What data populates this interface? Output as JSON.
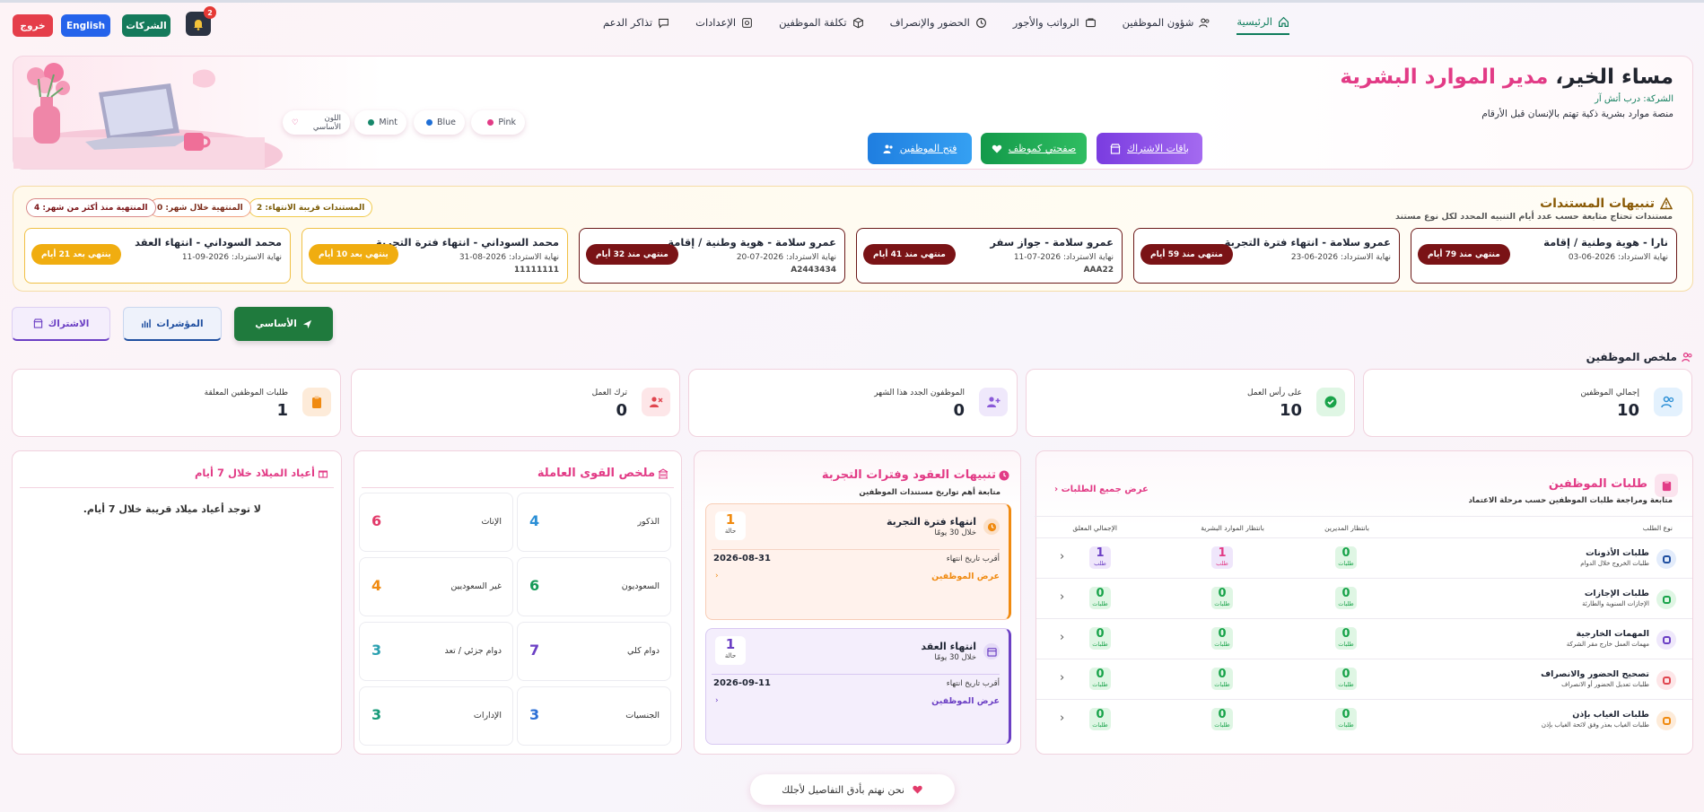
{
  "nav": {
    "home": "الرئيسية",
    "employees": "شؤون الموظفين",
    "payroll": "الرواتب والأجور",
    "attendance": "الحضور والإنصراف",
    "cost": "تكلفة الموظفين",
    "settings": "الإعدادات",
    "tickets": "تذاكر الدعم",
    "companies": "الشركات",
    "english": "English",
    "logout": "خروج",
    "notif_count": "2"
  },
  "hero": {
    "greet": "مساء الخير،",
    "role": "مدير الموارد البشرية",
    "company": "الشركة: درب أتش آر",
    "tagline": "منصة موارد بشرية ذكية تهتم بالإنسان قبل الأرقام",
    "btn_subscription": "باقات الاشتراك",
    "btn_employee_page": "صفحتي كموظف",
    "btn_open_employees": "فتح الموظفين",
    "themes": [
      "Pink",
      "Blue",
      "Mint",
      "اللون الأساسي"
    ]
  },
  "docs": {
    "title": "تنبيهات المستندات",
    "subtitle": "مستندات تحتاج متابعة حسب عدد أيام التنبيه المحدد لكل نوع مستند",
    "chips": {
      "near": "المستندات قريبة الانتهاء: 2",
      "month": "المنتهية خلال شهر: 0",
      "older": "المنتهية منذ أكثر من شهر: 4"
    },
    "cards": [
      {
        "name": "نارا - هوية وطنية / إقامة",
        "expiry": "نهاية الاسترداد: 2026-06-03",
        "number": "",
        "badge": "منتهي منذ 79 أيام"
      },
      {
        "name": "عمرو سلامة - انتهاء فترة التجربة",
        "expiry": "نهاية الاسترداد: 2026-06-23",
        "number": "",
        "badge": "منتهي منذ 59 أيام"
      },
      {
        "name": "عمرو سلامة - جواز سفر",
        "expiry": "نهاية الاسترداد: 2026-07-11",
        "number": "AAA22",
        "badge": "منتهي منذ 41 أيام"
      },
      {
        "name": "عمرو سلامة - هوية وطنية / إقامة",
        "expiry": "نهاية الاسترداد: 2026-07-20",
        "number": "A2443434",
        "badge": "منتهي منذ 32 أيام"
      },
      {
        "name": "محمد السوداني - انتهاء فترة التجربة",
        "expiry": "نهاية الاسترداد: 2026-08-31",
        "number": "11111111",
        "badge": "ينتهي بعد 10 أيام"
      },
      {
        "name": "محمد السوداني - انتهاء العقد",
        "expiry": "نهاية الاسترداد: 2026-09-11",
        "number": "",
        "badge": "ينتهي بعد 21 أيام"
      }
    ]
  },
  "tabs": {
    "main": "الأساسي",
    "indicators": "المؤشرات",
    "subscription": "الاشتراك"
  },
  "summary": {
    "title": "ملخص الموظفين",
    "stats": [
      {
        "label": "إجمالي الموظفين",
        "value": "10"
      },
      {
        "label": "على رأس العمل",
        "value": "10"
      },
      {
        "label": "الموظفون الجدد هذا الشهر",
        "value": "0"
      },
      {
        "label": "ترك العمل",
        "value": "0"
      },
      {
        "label": "طلبات الموظفين المعلقة",
        "value": "1"
      }
    ]
  },
  "requests": {
    "title": "طلبات الموظفين",
    "subtitle": "متابعة ومراجعة طلبات الموظفين حسب مرحلة الاعتماد",
    "view_all": "عرض جميع الطلبات",
    "headers": [
      "نوع الطلب",
      "بانتظار المديرين",
      "بانتظار الموارد البشرية",
      "الإجمالي المعلق"
    ],
    "unit": "طلب",
    "unit_pl": "طلبات",
    "rows": [
      {
        "name": "طلبات الأذونات",
        "desc": "طلبات الخروج خلال الدوام",
        "mgr": "0",
        "hr": "1",
        "total": "1"
      },
      {
        "name": "طلبات الإجازات",
        "desc": "الإجازات السنوية والطارئة",
        "mgr": "0",
        "hr": "0",
        "total": "0"
      },
      {
        "name": "المهمات الخارجية",
        "desc": "مهمات العمل خارج مقر الشركة",
        "mgr": "0",
        "hr": "0",
        "total": "0"
      },
      {
        "name": "تصحيح الحضور والانصراف",
        "desc": "طلبات تعديل الحضور أو الانصراف",
        "mgr": "0",
        "hr": "0",
        "total": "0"
      },
      {
        "name": "طلبات الغياب بإذن",
        "desc": "طلبات الغياب بعذر وفق لائحة الغياب بإذن",
        "mgr": "0",
        "hr": "0",
        "total": "0"
      }
    ]
  },
  "contracts": {
    "title": "تنبيهات العقود وفترات التجربة",
    "subtitle": "متابعة أهم تواريخ مستندات الموظفين",
    "items": [
      {
        "title": "انتهاء فترة التجربة",
        "period": "خلال 30 يومًا",
        "count": "1",
        "count_label": "حالة",
        "date_label": "أقرب تاريخ انتهاء",
        "date": "2026-08-31",
        "link": "عرض الموظفين"
      },
      {
        "title": "انتهاء العقد",
        "period": "خلال 30 يومًا",
        "count": "1",
        "count_label": "حالة",
        "date_label": "أقرب تاريخ انتهاء",
        "date": "2026-09-11",
        "link": "عرض الموظفين"
      }
    ]
  },
  "workforce": {
    "title": "ملخص القوى العاملة",
    "items": [
      {
        "label": "الذكور",
        "value": "4",
        "color": "#2b8fd6"
      },
      {
        "label": "الإناث",
        "value": "6",
        "color": "#e23b6a"
      },
      {
        "label": "السعوديون",
        "value": "6",
        "color": "#169a58"
      },
      {
        "label": "غير السعوديين",
        "value": "4",
        "color": "#f08a10"
      },
      {
        "label": "دوام كلي",
        "value": "7",
        "color": "#6b3fc4"
      },
      {
        "label": "دوام جزئي / تعد",
        "value": "3",
        "color": "#2aa0b0"
      },
      {
        "label": "الجنسيات",
        "value": "3",
        "color": "#2b6fd6"
      },
      {
        "label": "الإدارات",
        "value": "3",
        "color": "#169a78"
      }
    ]
  },
  "birthdays": {
    "title": "أعياد الميلاد خلال 7 أيام",
    "empty": "لا توجد أعياد ميلاد قريبة خلال 7 أيام."
  },
  "footer": {
    "text": "نحن نهتم بأدق التفاصيل لأجلك"
  }
}
